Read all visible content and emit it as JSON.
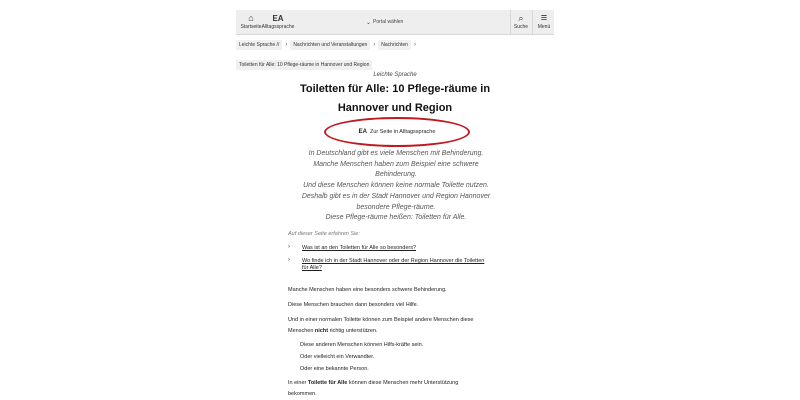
{
  "header": {
    "home_label": "Startseite",
    "language_label": "Alltagssprache",
    "language_icon": "EA",
    "portal_label": "Portal wählen",
    "search_label": "Suche",
    "menu_label": "Menü"
  },
  "breadcrumb": {
    "items": [
      "Leichte Sprache //",
      "Nachrichten und Veranstaltungen",
      "Nachrichten"
    ],
    "current": "Toiletten für Alle: 10 Pflege-räume in Hannover und Region"
  },
  "article": {
    "kicker": "Leichte Sprache",
    "title": "Toiletten für Alle: 10 Pflege-räume in Hannover und Region",
    "switch_link_icon": "EA",
    "switch_link_label": "Zur Seite in Alltagssprache",
    "intro_lines": [
      "In Deutschland gibt es viele Menschen mit Behinderung.",
      "Manche Menschen haben zum Beispiel eine schwere",
      "Behinderung.",
      "Und diese Menschen können keine normale Toilette nutzen.",
      "Deshalb gibt es in der Stadt Hannover und Region Hannover",
      "besondere Pflege-räume.",
      "Diese Pflege-räume heißen: Toiletten für Alle."
    ],
    "toc_heading": "Auf dieser Seite erfahren Sie:",
    "toc_items": [
      "Was ist an den Toiletten für Alle so besonders?",
      "Wo finde ich in der Stadt Hannover oder der Region Hannover die Toiletten für Alle?"
    ],
    "p1": "Manche Menschen haben eine besonders schwere Behinderung.",
    "p2": "Diese Menschen brauchen dann besonders viel Hilfe.",
    "p3_a": "Und in einer normalen Toilette können zum Beispiel andere Menschen diese",
    "p3_b_pre": "Menschen ",
    "p3_b_bold": "nicht",
    "p3_b_post": " richtig unterstützen.",
    "list": [
      "Diese anderen Menschen können Hilfs-kräfte sein.",
      "Oder vielleicht ein Verwandter.",
      "Oder eine bekannte Person."
    ],
    "p4_pre": "In einer ",
    "p4_bold": "Toilette für Alle",
    "p4_post": " können diese Menschen mehr Unterstützung",
    "p4_b": "bekommen."
  }
}
